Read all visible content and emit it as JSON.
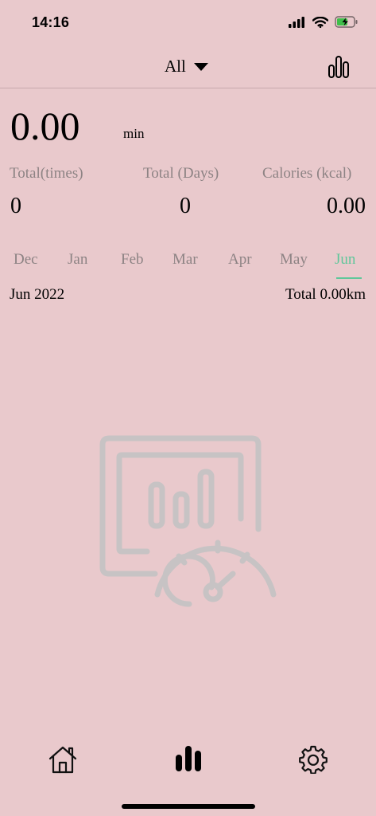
{
  "status_bar": {
    "time": "14:16"
  },
  "header": {
    "filter_label": "All"
  },
  "summary": {
    "duration": "0.00",
    "duration_unit": "min"
  },
  "stats": [
    {
      "label": "Total(times)",
      "value": "0"
    },
    {
      "label": "Total (Days)",
      "value": "0"
    },
    {
      "label": "Calories (kcal)",
      "value": "0.00"
    }
  ],
  "months": {
    "items": [
      "Dec",
      "Jan",
      "Feb",
      "Mar",
      "Apr",
      "May",
      "Jun"
    ],
    "selected": "Jun"
  },
  "period": {
    "label": "Jun 2022",
    "total": "Total 0.00km"
  },
  "colors": {
    "background": "#e9c9cc",
    "accent": "#5fc79a",
    "muted_text": "#8d8384",
    "illustration": "#c7c3c4"
  },
  "icons": {
    "status": [
      "cellular-signal-icon",
      "wifi-icon",
      "battery-charging-icon"
    ],
    "header": [
      "dropdown-triangle-icon",
      "bar-chart-icon"
    ],
    "tabs": [
      "home-icon",
      "statistics-icon",
      "settings-icon"
    ],
    "empty_state": "empty-chart-speedometer-icon"
  }
}
